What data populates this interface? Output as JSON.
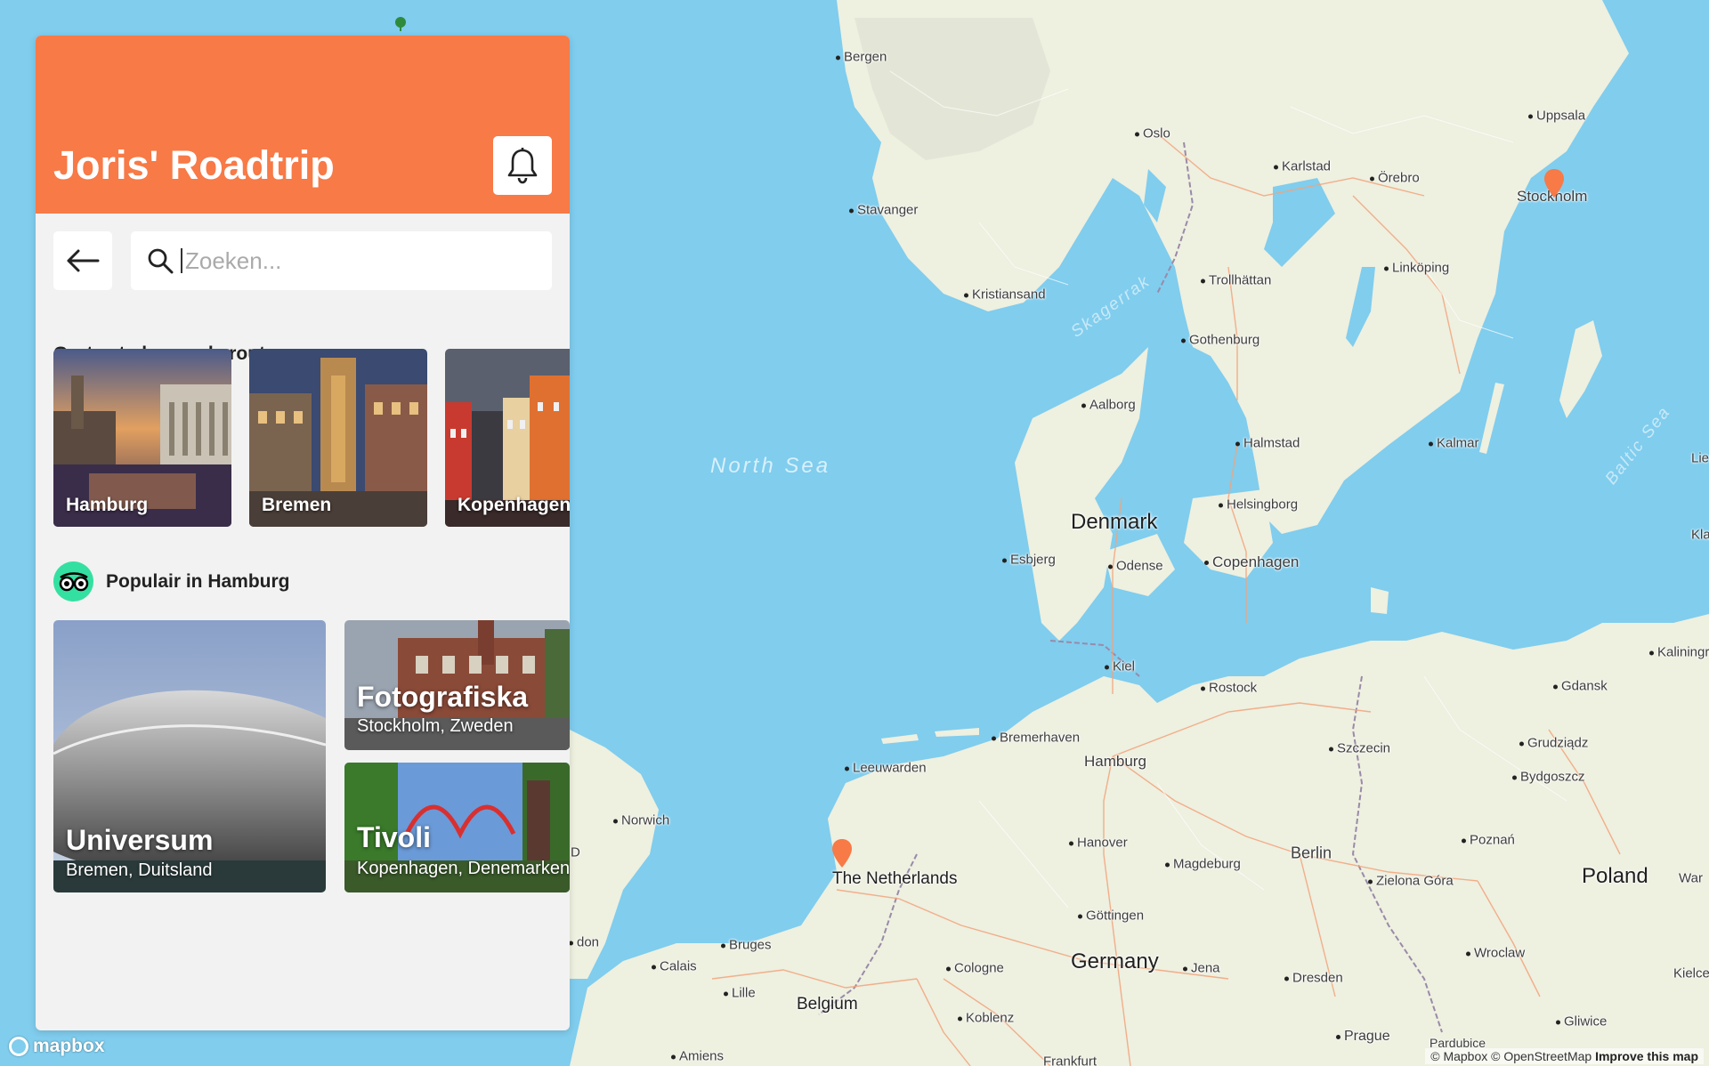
{
  "app": {
    "title": "Joris' Roadtrip"
  },
  "search": {
    "placeholder": "Zoeken..."
  },
  "cities_section": {
    "title": "Grote steden op de route",
    "cities": [
      {
        "label": "Hamburg"
      },
      {
        "label": "Bremen"
      },
      {
        "label": "Kopenhagen"
      }
    ]
  },
  "popular_section": {
    "title": "Populair in Hamburg",
    "items": [
      {
        "name": "Universum",
        "place": "Bremen, Duitsland"
      },
      {
        "name": "Fotografiska",
        "place": "Stockholm, Zweden"
      },
      {
        "name": "Tivoli",
        "place": "Kopenhagen, Denemarken"
      }
    ]
  },
  "map": {
    "countries": [
      "Denmark",
      "The Netherlands",
      "Germany",
      "Belgium",
      "Poland"
    ],
    "seas": [
      "North Sea",
      "Skagerrak",
      "Baltic Sea"
    ],
    "cities": [
      "Bergen",
      "Oslo",
      "Uppsala",
      "Karlstad",
      "Örebro",
      "Stockholm",
      "Stavanger",
      "Linköping",
      "Kristiansand",
      "Trollhättan",
      "Gothenburg",
      "Aalborg",
      "Halmstad",
      "Kalmar",
      "Helsingborg",
      "Esbjerg",
      "Odense",
      "Copenhagen",
      "Kiel",
      "Rostock",
      "Gdansk",
      "Kaliningra",
      "Bremerhaven",
      "Hamburg",
      "Szczecin",
      "Grudziądz",
      "Leeuwarden",
      "Bydgoszcz",
      "Norwich",
      "Hanover",
      "Berlin",
      "Poznań",
      "Magdeburg",
      "Zielona Góra",
      "Göttingen",
      "Bruges",
      "Calais",
      "Cologne",
      "Jena",
      "Dresden",
      "Wroclaw",
      "Lille",
      "Kielce",
      "Gliwice",
      "Koblenz",
      "Prague",
      "Pardubice",
      "Amiens",
      "Frankfurt",
      "don",
      "D",
      "Lie",
      "Kla",
      "War"
    ],
    "attribution": "© Mapbox © OpenStreetMap",
    "improve_link": "Improve this map",
    "logo": "mapbox"
  },
  "colors": {
    "accent": "#f77a47",
    "water": "#80cdee",
    "land": "#eef0e0",
    "panel_bg": "#f2f2f2",
    "tripadvisor": "#34e0a1"
  },
  "icons": [
    "bell-icon",
    "arrow-left-icon",
    "search-icon",
    "tripadvisor-icon",
    "map-pin-icon"
  ]
}
